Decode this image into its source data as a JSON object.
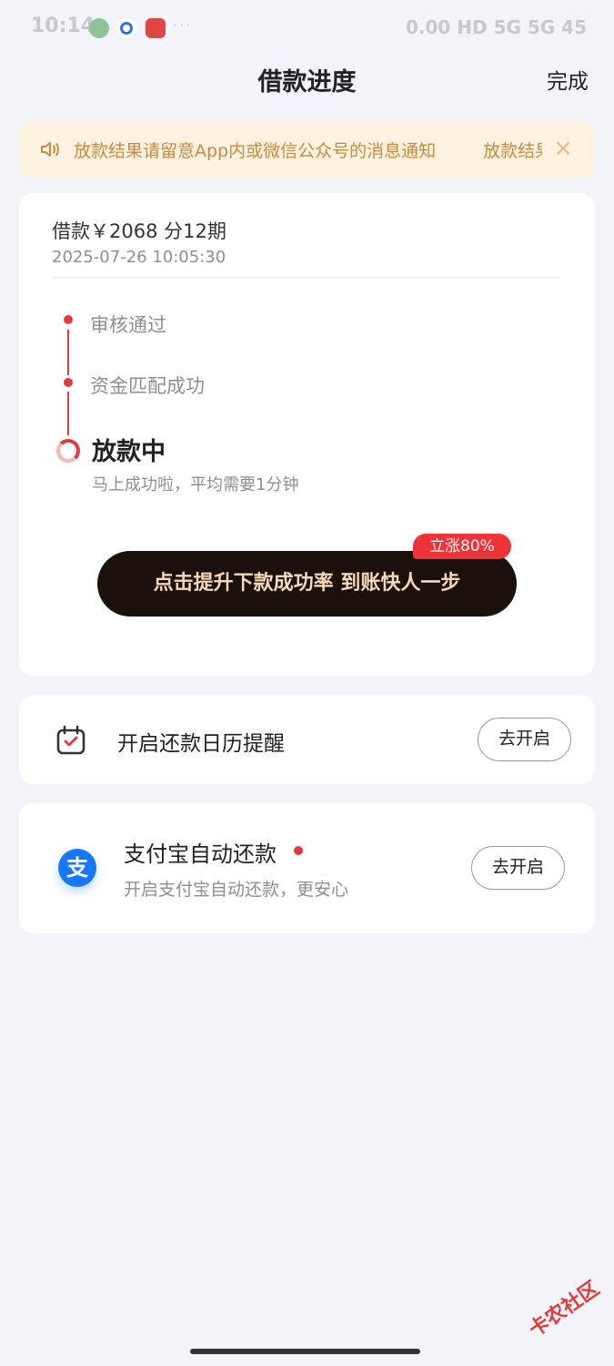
{
  "status_bar": {
    "time": "10:14",
    "right_text": "0.00 HD 5G 5G 45"
  },
  "header": {
    "title": "借款进度",
    "done_label": "完成"
  },
  "notice": {
    "text": "放款结果请留意App内或微信公众号的消息通知",
    "text_repeat": "放款结果请留意App内或微信公众号的消息通知",
    "close_icon": "×",
    "icon": "speaker-icon"
  },
  "loan": {
    "amount_text": "借款￥2068  分12期",
    "datetime": "2025-07-26 10:05:30"
  },
  "timeline": {
    "steps": [
      {
        "label": "审核通过",
        "status": "done"
      },
      {
        "label": "资金匹配成功",
        "status": "done"
      },
      {
        "label": "放款中",
        "status": "current",
        "sub": "马上成功啦，平均需要1分钟"
      }
    ]
  },
  "cta": {
    "label": "点击提升下款成功率 到账快人一步",
    "badge": "立涨80%"
  },
  "calendar_card": {
    "icon": "calendar-check-icon",
    "label": "开启还款日历提醒",
    "button": "去开启"
  },
  "alipay_card": {
    "icon_glyph": "支",
    "title": "支付宝自动还款",
    "subtitle": "开启支付宝自动还款，更安心",
    "button": "去开启"
  },
  "watermark": "卡农社区",
  "colors": {
    "accent_red": "#e5393c",
    "notice_bg": "#fdf1df",
    "notice_text": "#c88a3c",
    "cta_bg": "#1b110c",
    "cta_text": "#f4d8b8",
    "alipay_blue": "#1677ff"
  }
}
